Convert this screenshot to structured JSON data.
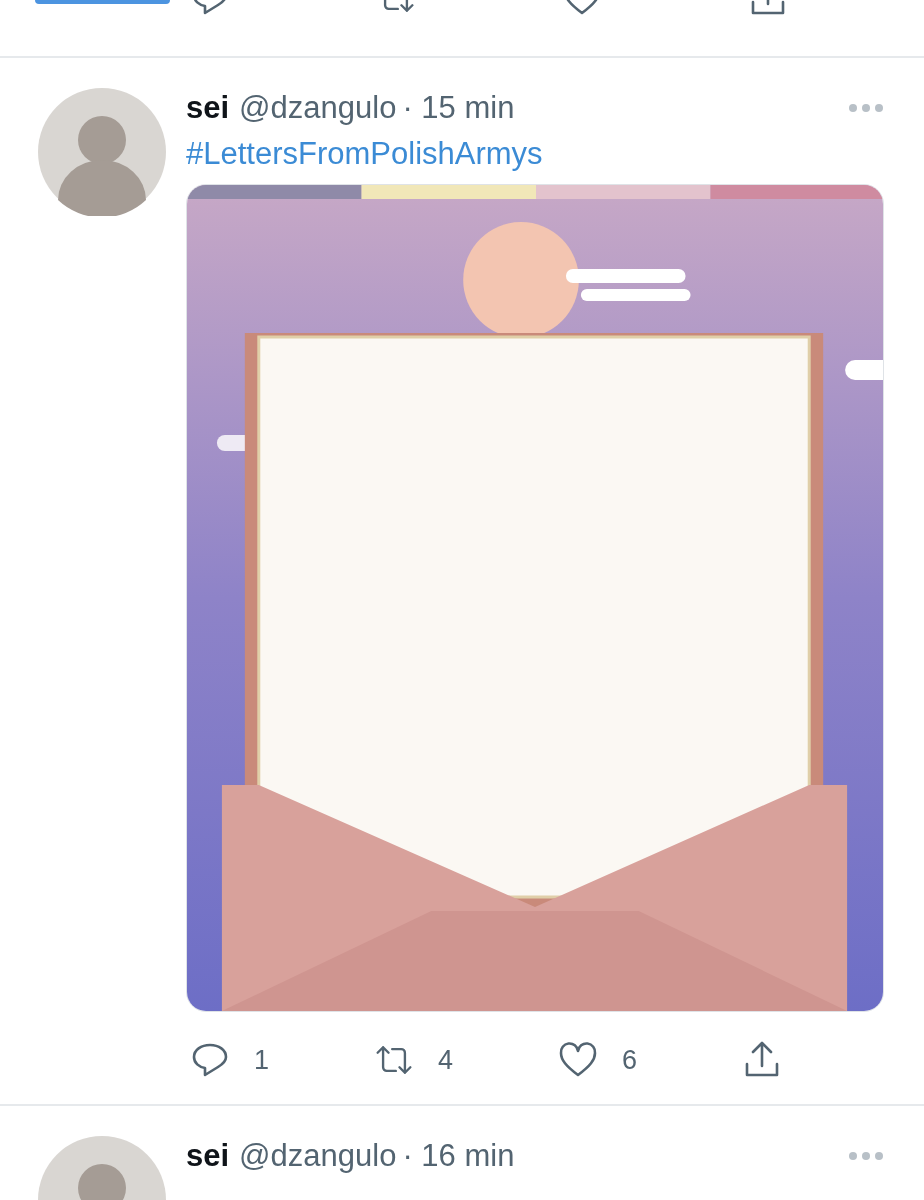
{
  "previous_tweet": {
    "kind": "cut_actions"
  },
  "tweets": [
    {
      "name": "sei",
      "handle": "@dzangulo",
      "time": "· 15 min",
      "text": "#LettersFromPolishArmys",
      "actions": [
        {
          "kind": "reply",
          "count": "1"
        },
        {
          "kind": "retweet",
          "count": "4"
        },
        {
          "kind": "like",
          "count": "6"
        },
        {
          "kind": "share"
        }
      ]
    },
    {
      "name": "sei",
      "handle": "@dzangulo",
      "time": "· 16 min"
    }
  ]
}
